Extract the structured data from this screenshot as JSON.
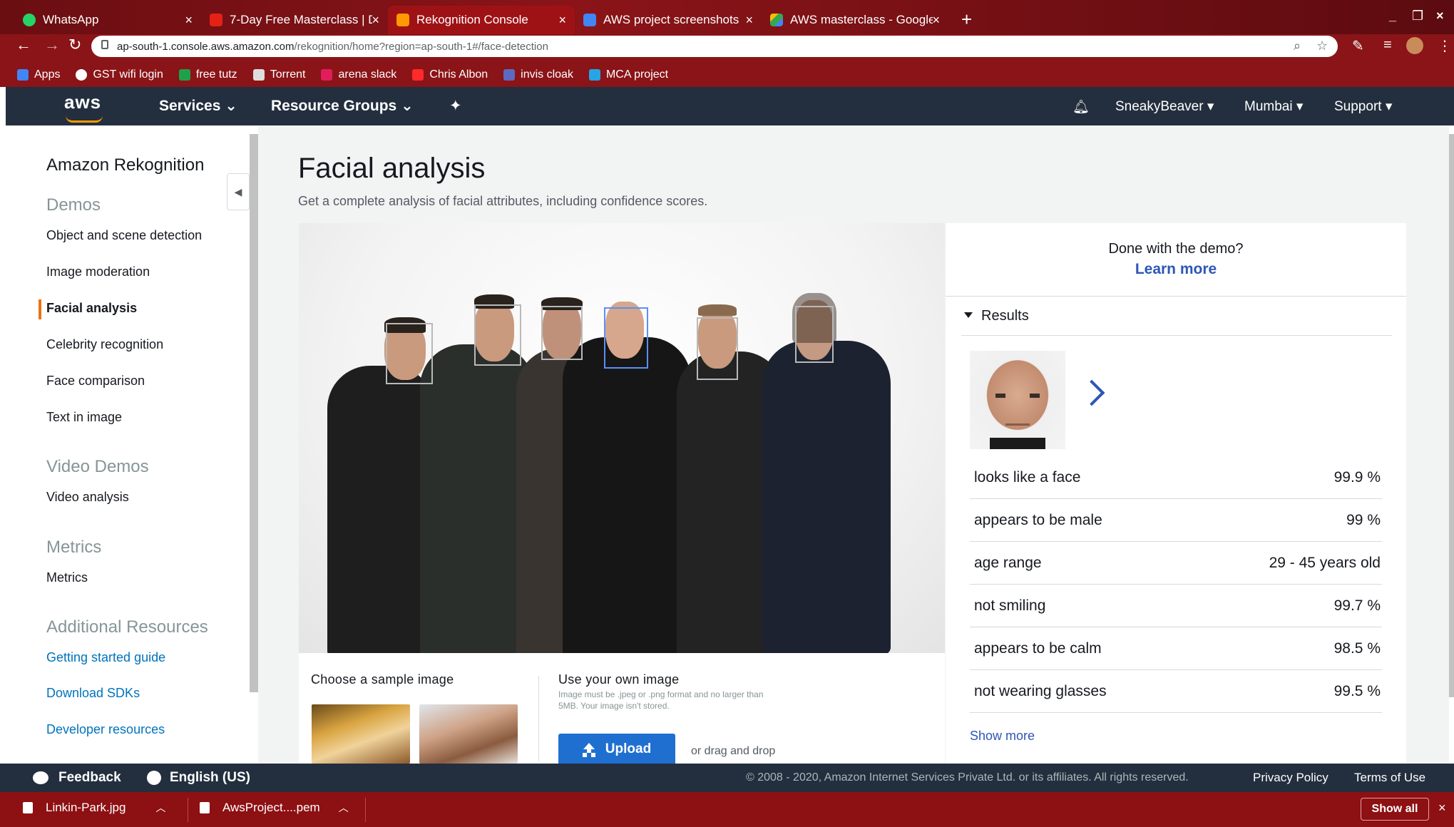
{
  "browser": {
    "tabs": [
      {
        "label": "WhatsApp",
        "color": "#25d366"
      },
      {
        "label": "7-Day Free Masterclass | D",
        "color": "#e62117"
      },
      {
        "label": "Rekognition Console",
        "color": "#ff9900"
      },
      {
        "label": "AWS project screenshots",
        "color": "#4285f4"
      },
      {
        "label": "AWS masterclass - Google",
        "color": "#fbbc04"
      }
    ],
    "url_host": "ap-south-1.console.aws.amazon.com",
    "url_path": "/rekognition/home?region=ap-south-1#/face-detection",
    "bookmarks": [
      {
        "label": "Apps",
        "color": "#4285f4"
      },
      {
        "label": "GST wifi login",
        "color": "#ffffff"
      },
      {
        "label": "free tutz",
        "color": "#1fa14a"
      },
      {
        "label": "Torrent",
        "color": "#dddddd"
      },
      {
        "label": "arena slack",
        "color": "#e01e5a"
      },
      {
        "label": "Chris Albon",
        "color": "#ff2a2a"
      },
      {
        "label": "invis cloak",
        "color": "#5c6bc0"
      },
      {
        "label": "MCA project",
        "color": "#26a5e4"
      }
    ]
  },
  "aws_nav": {
    "logo": "aws",
    "services": "Services",
    "resource_groups": "Resource Groups",
    "account": "SneakyBeaver",
    "region": "Mumbai",
    "support": "Support",
    "brand_color": "#232f3e",
    "accent_color": "#ff9900"
  },
  "sidebar": {
    "title": "Amazon Rekognition",
    "sections": [
      {
        "heading": "Demos",
        "items": [
          "Object and scene detection",
          "Image moderation",
          "Facial analysis",
          "Celebrity recognition",
          "Face comparison",
          "Text in image"
        ]
      },
      {
        "heading": "Video Demos",
        "items": [
          "Video analysis"
        ]
      },
      {
        "heading": "Metrics",
        "items": [
          "Metrics"
        ]
      },
      {
        "heading": "Additional Resources",
        "items": [
          "Getting started guide",
          "Download SDKs",
          "Developer resources"
        ]
      }
    ],
    "active_item": "Facial analysis"
  },
  "main": {
    "title": "Facial analysis",
    "subtitle": "Get a complete analysis of facial attributes, including confidence scores.",
    "choose_sample": "Choose a sample image",
    "own_image": "Use your own image",
    "own_note": "Image must be .jpeg or .png format and no larger than 5MB. Your image isn't stored.",
    "upload": "Upload",
    "drag_drop": "or drag and drop"
  },
  "results_panel": {
    "done": "Done with the demo?",
    "learn_more": "Learn more",
    "heading": "Results",
    "rows": [
      {
        "label": "looks like a face",
        "value": "99.9 %"
      },
      {
        "label": "appears to be male",
        "value": "99 %"
      },
      {
        "label": "age range",
        "value": "29 - 45 years old"
      },
      {
        "label": "not smiling",
        "value": "99.7 %"
      },
      {
        "label": "appears to be calm",
        "value": "98.5 %"
      },
      {
        "label": "not wearing glasses",
        "value": "99.5 %"
      }
    ],
    "show_more": "Show more"
  },
  "footer": {
    "feedback": "Feedback",
    "language": "English (US)",
    "copyright": "© 2008 - 2020, Amazon Internet Services Private Ltd. or its affiliates. All rights reserved.",
    "privacy": "Privacy Policy",
    "terms": "Terms of Use"
  },
  "downloads": {
    "items": [
      "Linkin-Park.jpg",
      "AwsProject....pem"
    ],
    "show_all": "Show all"
  }
}
